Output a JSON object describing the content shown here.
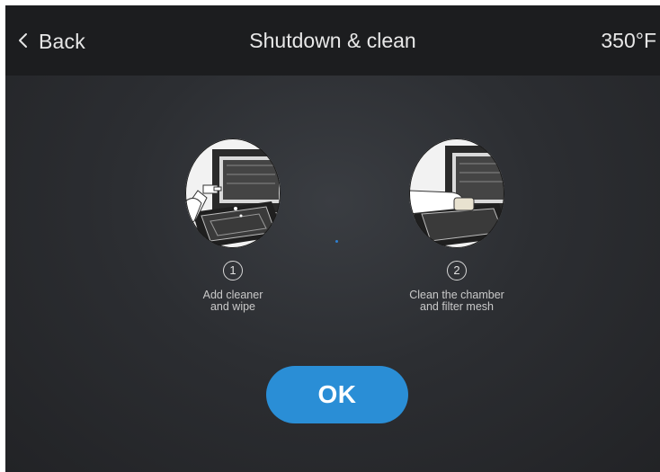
{
  "header": {
    "back_label": "Back",
    "title": "Shutdown & clean",
    "temperature": "350°F",
    "back_icon": "chevron-left-icon"
  },
  "steps": [
    {
      "number": "1",
      "caption_line1": "Add cleaner",
      "caption_line2": "and wipe",
      "image": "spray-cleaner-illustration"
    },
    {
      "number": "2",
      "caption_line1": "Clean the chamber",
      "caption_line2": "and filter mesh",
      "image": "wipe-chamber-illustration"
    }
  ],
  "ok_label": "OK",
  "colors": {
    "accent": "#2a8ed6",
    "header_bg": "#1c1d1f",
    "background": "#2c2e32"
  }
}
